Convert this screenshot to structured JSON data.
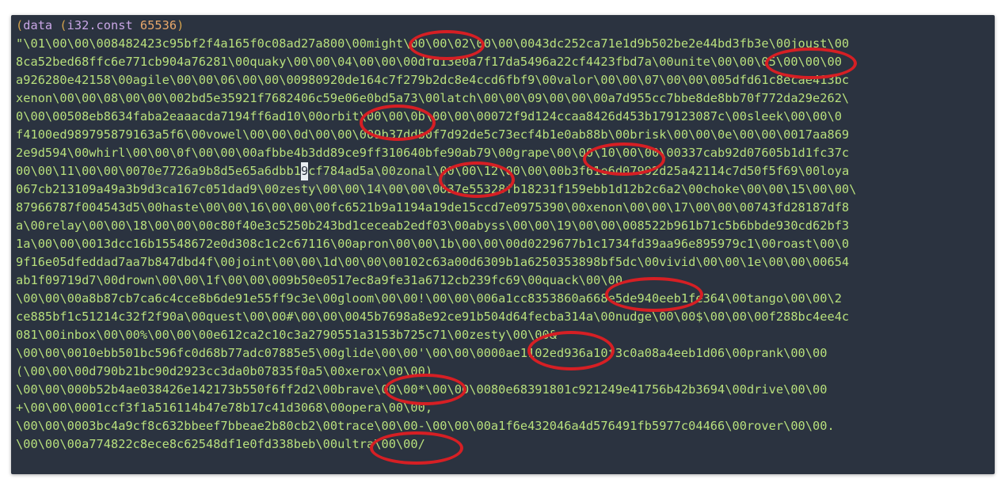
{
  "header": {
    "open_paren": "(",
    "keyword": "data",
    "inner_open": " (",
    "const_op": "i32.const",
    "const_value": " 65536",
    "close_paren": ")"
  },
  "editor": {
    "lines": [
      "\"\\01\\00\\00\\008482423c95bf2f4a165f0c08ad27a800\\00might\\00\\00\\02\\00\\00\\0043dc252ca71e1d9b502be2e44bd3fb3e\\00joust\\00",
      "8ca52bed68ffc6e771cb904a76281\\00quaky\\00\\00\\04\\00\\00\\00dfd13e0a7f17da5496a22cf4423fbd7a\\00unite\\00\\00\\05\\00\\00\\00",
      "a926280e42158\\00agile\\00\\00\\06\\00\\00\\00980920de164c7f279b2dc8e4ccd6fbf9\\00valor\\00\\00\\07\\00\\00\\005dfd61c8ecae413bc",
      "xenon\\00\\00\\08\\00\\00\\002bd5e35921f7682406c59e06e0bd5a73\\00latch\\00\\00\\09\\00\\00\\00a7d955cc7bbe8de8bb70f772da29e262\\",
      "0\\00\\00508eb8634faba2eaaacda7194ff6ad10\\00orbit\\00\\00\\0b\\00\\00\\00072f9d124ccaa8426d453b179123087c\\00sleek\\00\\00\\0",
      "f4100ed989795879163a5f6\\00vowel\\00\\00\\0d\\00\\00\\009b37ddb0f7d92de5c73ecf4b1e0ab88b\\00brisk\\00\\00\\0e\\00\\00\\0017aa869",
      "2e9d594\\00whirl\\00\\00\\0f\\00\\00\\00afbbe4b3dd89ce9ff310640bfe90ab79\\00grape\\00\\00\\10\\00\\00\\00337cab92d07605b1d1fc37c",
      "00\\00\\11\\00\\00\\0070e7726a9b8d5e65a6dbb1",
      "067cb213109a49a3b9d3ca167c051dad9\\00zesty\\00\\00\\14\\00\\00\\0037e55328fb18231f159ebb1d12b2c6a2\\00choke\\00\\00\\15\\00\\00\\",
      "87966787f004543d5\\00haste\\00\\00\\16\\00\\00\\00fc6521b9a1194a19de15ccd7e0975390\\00xenon\\00\\00\\17\\00\\00\\00743fd28187df8",
      "a\\00relay\\00\\00\\18\\00\\00\\00c80f40e3c5250b243bd1ceceab2edf03\\00abyss\\00\\00\\19\\00\\00\\008522b961b71c5b6bbde930cd62bf3",
      "1a\\00\\00\\0013dcc16b15548672e0d308c1c2c67116\\00apron\\00\\00\\1b\\00\\00\\00d0229677b1c1734fd39aa96e895979c1\\00roast\\00\\0",
      "9f16e05dfeddad7aa7b847dbd4f\\00joint\\00\\00\\1d\\00\\00\\00102c63a00d6309b1a6250353898bf5dc\\00vivid\\00\\00\\1e\\00\\00\\00654",
      "ab1f09719d7\\00drown\\00\\00\\1f\\00\\00\\009b50e0517ec8a9fe31a6712cb239fc69\\00quack\\00\\00",
      "\\00\\00\\00a8b87cb7ca6c4cce8b6de91e55ff9c3e\\00gloom\\00\\00!\\00\\00\\006a1cc8353860a668e5de940eeb1fe364\\00tango\\00\\00\\2",
      "ce885bf1c51214c32f2f90a\\00quest\\00\\00#\\00\\00\\0045b7698a8e92ce91b504d64fecba314a\\00nudge\\00\\00$\\00\\00\\00f288bc4ee4c",
      "081\\00inbox\\00\\00%\\00\\00\\00e612ca2c10c3a2790551a3153b725c71\\00zesty\\00\\00&",
      "\\00\\00\\0010ebb501bc596fc0d68b77adc07885e5\\00glide\\00\\00'\\00\\00\\0000ae1102ed936a10f3c0a08a4eeb1d06\\00prank\\00\\00",
      "(\\00\\00\\00d790b21bc90d2923cc3da0b07835f0a5\\00xerox\\00\\00)",
      "\\00\\00\\000b52b4ae038426e142173b550f6ff2d2\\00brave\\00\\00*\\00\\00\\0080e68391801c921249e41756b42b3694\\00drive\\00\\00",
      "+\\00\\00\\0001ccf3f1a516114b47e78b17c41d3068\\00opera\\00\\00,",
      "\\00\\00\\0003bc4a9cf8c632bbeef7bbeae2b80cb2\\00trace\\00\\00-\\00\\00\\00a1f6e432046a4d576491fb5977c04466\\00rover\\00\\00.",
      "\\00\\00\\00a774822c8ece8c62548df1e0fd338beb\\00ultra\\00\\00/"
    ],
    "line8_after_cursor": "cf784ad5a\\00zonal\\00\\00\\12\\00\\00\\00b3f61e6d07992d25a42114c7d50f5f69\\00loya",
    "cursor_char": "9"
  },
  "colors": {
    "background": "#2b3340",
    "string_text": "#b8e07c",
    "annotation": "#d61f24"
  }
}
